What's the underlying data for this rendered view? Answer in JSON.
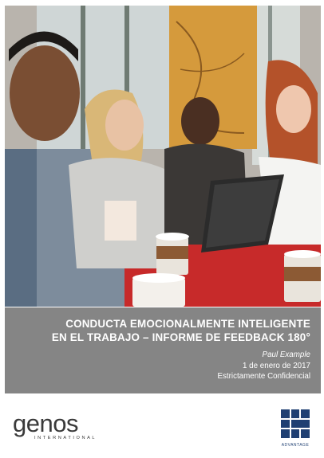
{
  "cover": {
    "title_line1": "CONDUCTA EMOCIONALMENTE INTELIGENTE",
    "title_line2": "EN EL TRABAJO – INFORME DE FEEDBACK 180°",
    "person_name": "Paul Example",
    "date": "1 de enero de 2017",
    "confidentiality": "Estrictamente Confidencial"
  },
  "logos": {
    "genos_word": "genos",
    "genos_sub": "INTERNATIONAL",
    "advantage_sub": "ADVANTAGE"
  },
  "colors": {
    "banner": "#858585",
    "brand_navy": "#1f3f72",
    "logo_text": "#3a3a3a"
  }
}
